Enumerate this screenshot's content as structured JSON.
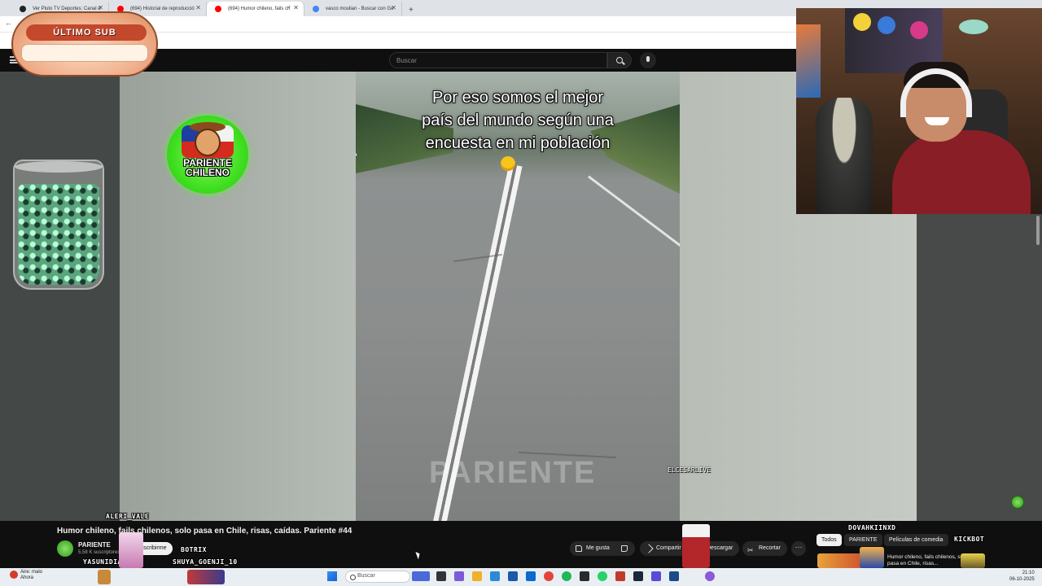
{
  "browser": {
    "tabs": [
      {
        "label": "Ver Pluto TV Deportes: Canal d",
        "favicon_color": "#222222"
      },
      {
        "label": "(694) Historial de reproducció",
        "favicon_color": "#ff0000"
      },
      {
        "label": "(694) Humor chileno, fails ch",
        "favicon_color": "#ff0000"
      },
      {
        "label": "vasco moulian - Buscar con Go",
        "favicon_color": "#4285f4"
      }
    ],
    "new_tab": "+"
  },
  "youtube": {
    "search_placeholder": "Buscar",
    "video": {
      "caption_lines": [
        "Por eso somos el mejor",
        "país del mundo según una",
        "encuesta en mi población"
      ],
      "watermark": "PARIENTE",
      "handle": "ELCESARLIVE"
    },
    "title": "Humor chileno, fails chilenos, solo pasa en Chile, risas, caídas. Pariente #44",
    "channel": {
      "name": "PARIENTE",
      "subscribers": "5,58 K suscriptores",
      "subscribe_label": "Suscribirme"
    },
    "actions": {
      "like": "Me gusta",
      "share": "Compartir",
      "download": "Descargar",
      "clip": "Recortar",
      "more": "···"
    },
    "chips": [
      "Todos",
      "PARIENTE",
      "Películas de comedia"
    ],
    "related": {
      "title": "Humor chileno, fails chilenos, solo pasa en Chile, risas..."
    }
  },
  "overlay": {
    "last_sub_label": "ÚLTIMO SUB",
    "logo_text": [
      "PARIENTE",
      "CHILENO"
    ],
    "chat_names": {
      "a": "ALERI_VALE",
      "b": "BOTRIX",
      "c": "YASUNIDIA",
      "d": "SHUYA_GOENJI_10",
      "e": "DOVAHKIINXD",
      "f": "KICKBOT"
    }
  },
  "taskbar": {
    "weather_title": "Aire: malo",
    "weather_sub": "Ahora",
    "search": "Buscar",
    "time": "21:10",
    "date": "06-10-2025"
  },
  "colors": {
    "yt_bg": "#0f0f0f",
    "accent": "#ff0000",
    "logo_green": "#3fe020"
  }
}
